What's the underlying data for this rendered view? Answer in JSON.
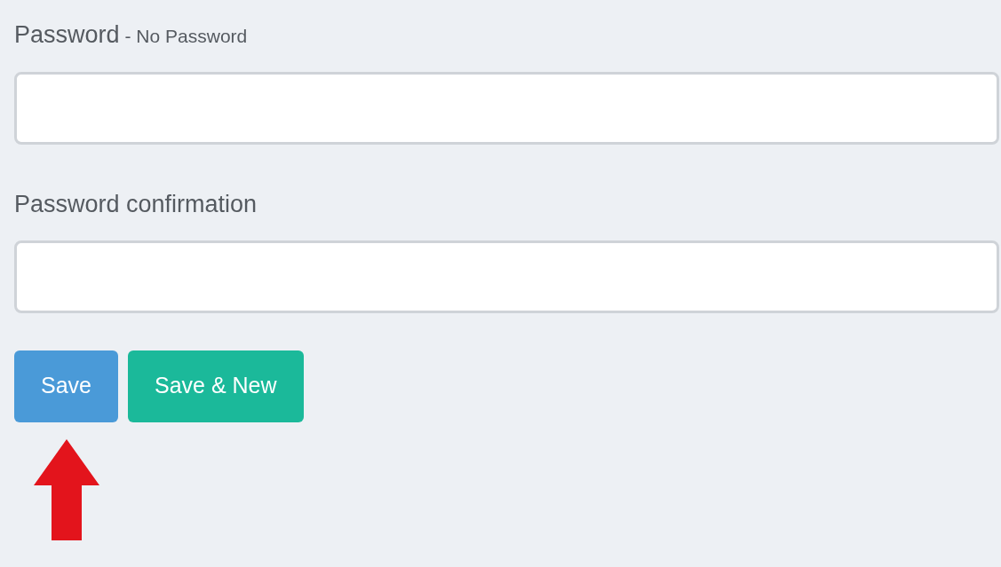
{
  "fields": [
    {
      "label": "Password",
      "note": "- No Password"
    },
    {
      "label": "Password confirmation"
    }
  ],
  "buttons": [
    {
      "label": "Save",
      "kind": "primary"
    },
    {
      "label": "Save & New",
      "kind": "success"
    }
  ]
}
